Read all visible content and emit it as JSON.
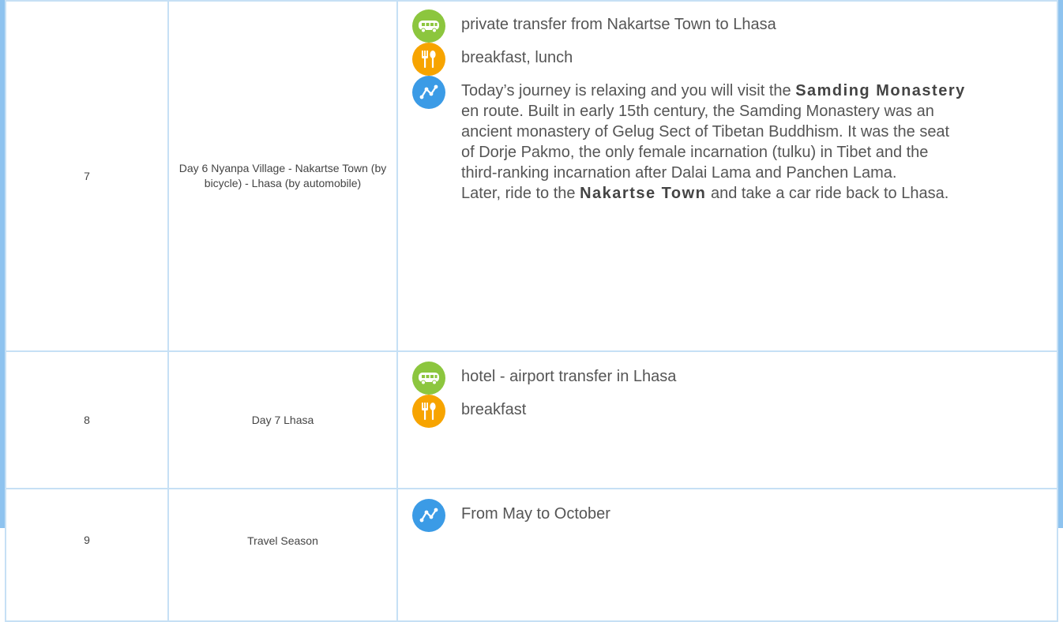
{
  "rows": [
    {
      "num": "7",
      "title": "Day 6 Nyanpa Village - Nakartse Town (by bicycle) - Lhasa (by automobile)",
      "transport": "private transfer from Nakartse Town to Lhasa",
      "meals": "breakfast, lunch",
      "itinerary": {
        "p1_a": "Today’s journey is relaxing and you will visit the ",
        "p1_b": "Samding Monastery",
        "p1_c": " en route. Built in early 15th century, the Samding Monastery was an ancient monastery of Gelug Sect of Tibetan Buddhism. It was the seat of Dorje Pakmo, the only female incarnation (tulku) in Tibet and the third-ranking incarnation after Dalai Lama and Panchen Lama.",
        "p2_a": "Later, ride to the ",
        "p2_b": "Nakartse Town",
        "p2_c": " and take a car ride back to Lhasa."
      }
    },
    {
      "num": "8",
      "title": "Day 7 Lhasa",
      "transport": "hotel - airport transfer in Lhasa",
      "meals": "breakfast"
    },
    {
      "num": "9",
      "title": "Travel Season",
      "season": "From May to October"
    }
  ],
  "icons": {
    "transport": "bus-icon",
    "meals": "fork-spoon-icon",
    "itinerary": "route-icon"
  },
  "colors": {
    "border": "#c6e0f5",
    "frame": "#8ec3ef",
    "bus": "#8cc63e",
    "meal": "#f7a400",
    "route": "#3b9be6"
  }
}
